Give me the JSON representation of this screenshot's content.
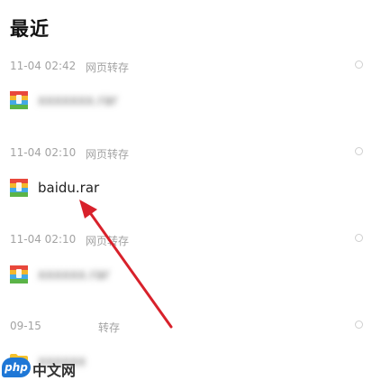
{
  "page_title": "最近",
  "groups": [
    {
      "time": "11-04 02:42",
      "source": "网页转存",
      "file": {
        "name": "xxxxxxx.rar",
        "icon": "rar-archive-icon",
        "blurred": true
      }
    },
    {
      "time": "11-04 02:10",
      "source": "网页转存",
      "file": {
        "name": "baidu.rar",
        "icon": "rar-archive-icon",
        "blurred": false
      }
    },
    {
      "time": "11-04 02:10",
      "source": "网页转存",
      "file": {
        "name": "xxxxxx.rar",
        "icon": "rar-archive-icon",
        "blurred": true
      }
    },
    {
      "time": "09-15",
      "source": "转存",
      "file": {
        "name": "xxxxxx",
        "icon": "folder-icon",
        "blurred": true
      }
    }
  ],
  "watermark": {
    "badge": "php",
    "text": "中文网"
  },
  "colors": {
    "arrow": "#d8212b",
    "meta_text": "#a3a3a3",
    "folder": "#f5c22d"
  }
}
